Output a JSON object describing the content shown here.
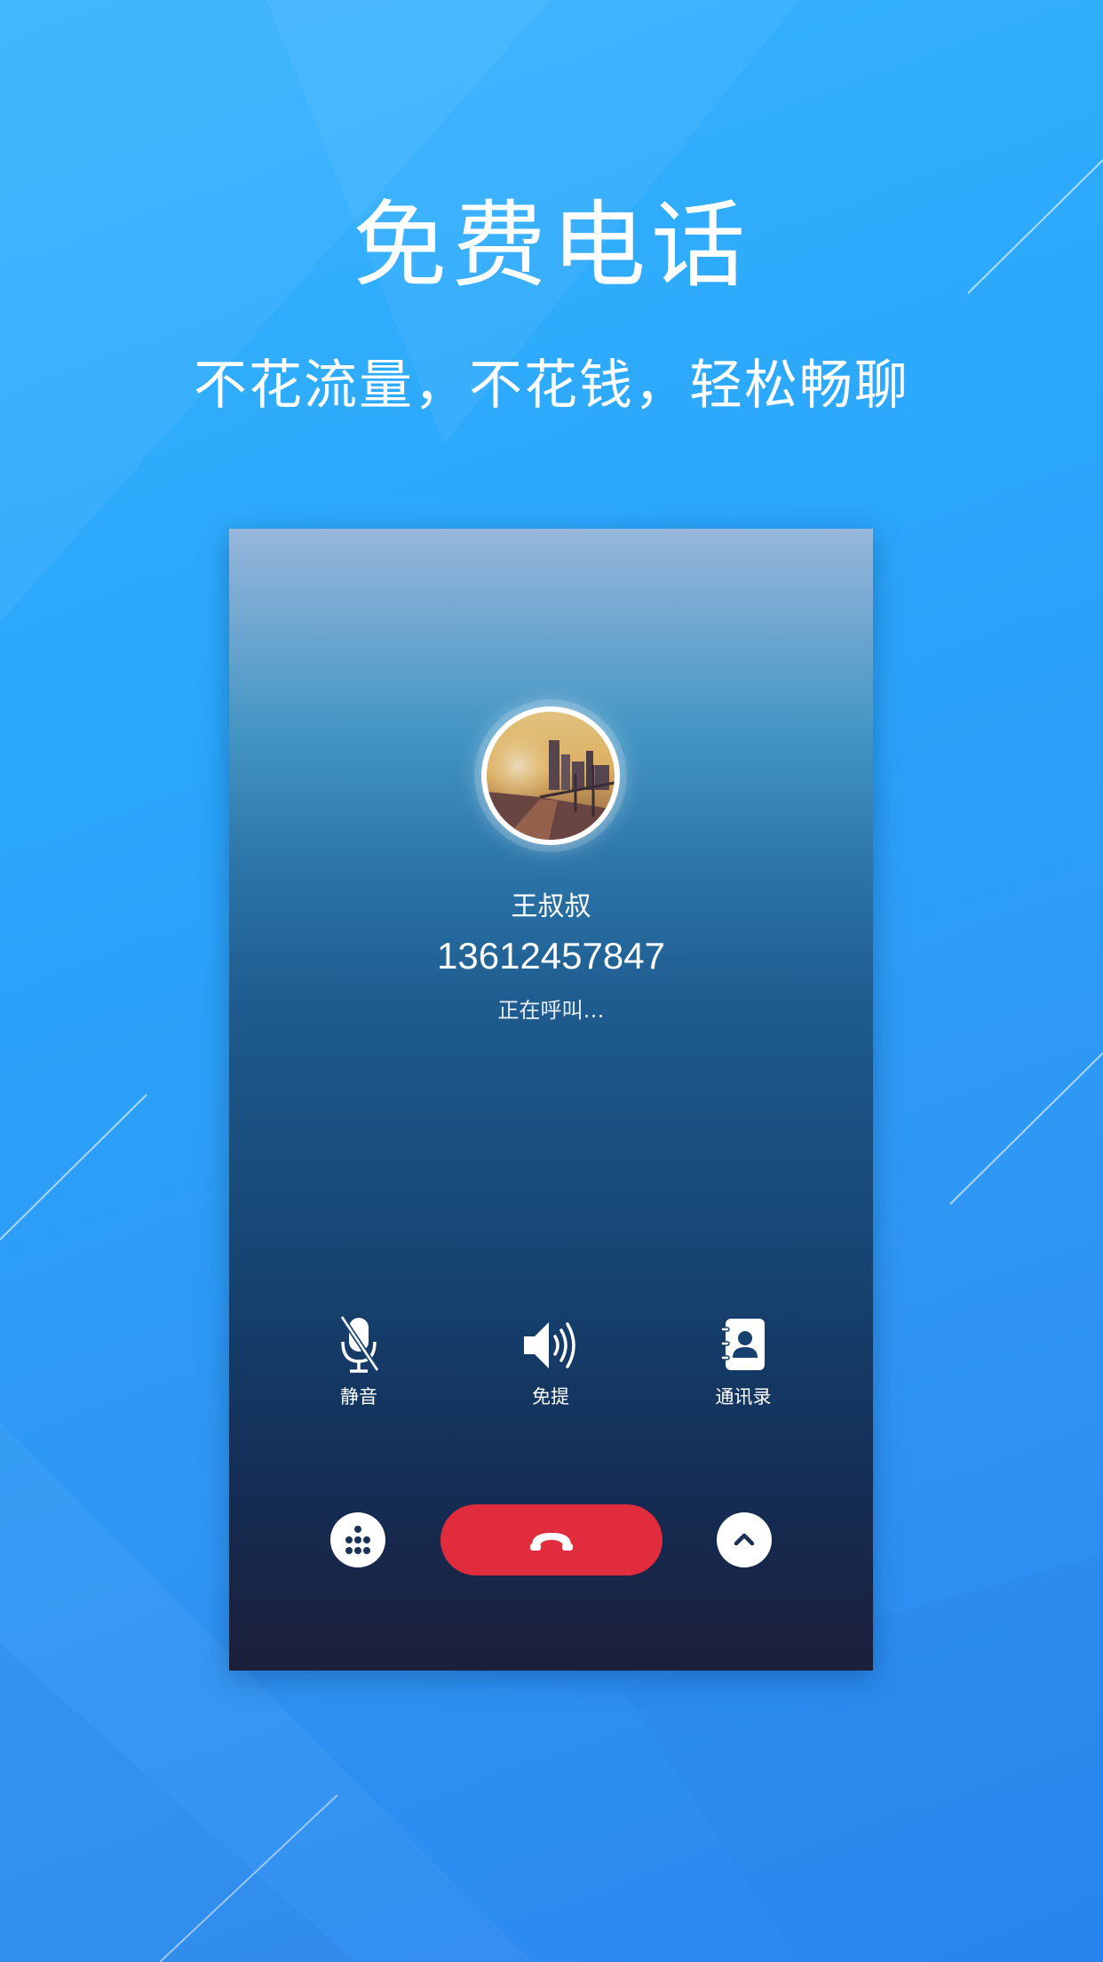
{
  "promo": {
    "title": "免费电话",
    "subtitle": "不花流量，不花钱，轻松畅聊"
  },
  "call": {
    "contact_name": "王叔叔",
    "phone_number": "13612457847",
    "status": "正在呼叫…"
  },
  "controls": {
    "mute_label": "静音",
    "speaker_label": "免提",
    "contacts_label": "通讯录"
  },
  "icons": {
    "mute": "microphone-off-icon",
    "speaker": "speaker-icon",
    "contacts": "contacts-book-icon",
    "keypad": "dialpad-icon",
    "hangup": "phone-hangup-icon",
    "collapse": "chevron-up-icon"
  },
  "colors": {
    "background": "#2ea6fb",
    "hangup": "#e02c3c",
    "text": "#ffffff"
  }
}
